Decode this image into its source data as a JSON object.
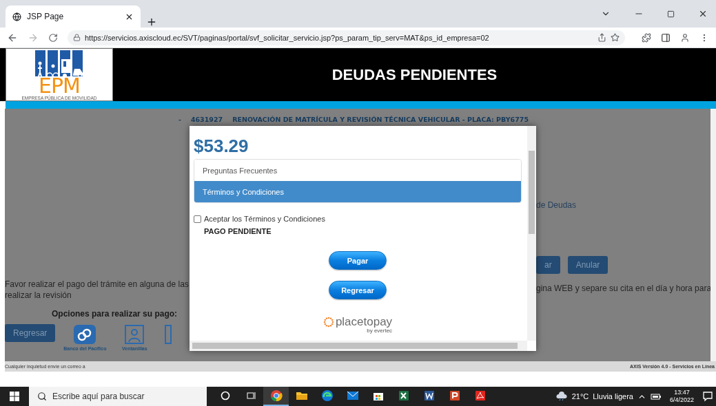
{
  "browser": {
    "tab_title": "JSP Page",
    "url": "https://servicios.axiscloud.ec/SVT/paginas/portal/svf_solicitar_servicio.jsp?ps_param_tip_serv=MAT&ps_id_empresa=02"
  },
  "header": {
    "logo_text": "EPM",
    "logo_subtitle": "EMPRESA PÚBLICA DE MOVILIDAD",
    "title": "DEUDAS PENDIENTES"
  },
  "service_line": {
    "dash": "-",
    "number": "4631927",
    "description": "RENOVACIÓN DE MATRÍCULA Y REVISIÓN TÉCNICA VEHICULAR - PLACA: PBY6775"
  },
  "background": {
    "right_link": "de Deudas",
    "right_buttons": [
      "ar",
      "Anular"
    ],
    "notice_left": "Favor realizar el pago del trámite en alguna de las",
    "notice_right": "gina WEB y separe su cita en el día y hora para",
    "notice_continued": "realizar la revisión",
    "payment_options_title": "Opciones para realizar su pago:",
    "back_button": "Regresar",
    "payment_options": [
      {
        "kind": "bank",
        "label": "Banco del Pacífico"
      },
      {
        "kind": "counter",
        "label": "Ventanillas"
      },
      {
        "kind": "partial"
      }
    ]
  },
  "modal": {
    "amount": "$53.29",
    "menu": [
      {
        "label": "Preguntas Frecuentes",
        "selected": false
      },
      {
        "label": "Términos y Condiciones",
        "selected": true
      }
    ],
    "accept_checkbox": {
      "label": "Aceptar los Términos y Condiciones",
      "checked": false
    },
    "status": "PAGO PENDIENTE",
    "buttons": [
      "Pagar",
      "Regresar"
    ],
    "brand": {
      "name": "placetopay",
      "byline": "by evertec"
    }
  },
  "footer": {
    "left": "Cualquier inquietud envíe un correo a",
    "right": "AXIS Versión 4.0 - Servicios en Línea"
  },
  "taskbar": {
    "search_placeholder": "Escribe aquí para buscar",
    "apps": [
      {
        "kind": "cortana",
        "selected": false
      },
      {
        "kind": "taskview",
        "selected": false
      },
      {
        "kind": "chrome",
        "selected": true
      },
      {
        "kind": "folder",
        "selected": false
      },
      {
        "kind": "edge",
        "selected": false
      },
      {
        "kind": "mail",
        "selected": false
      },
      {
        "kind": "store",
        "selected": false
      },
      {
        "kind": "excel",
        "selected": false
      },
      {
        "kind": "word",
        "selected": false
      },
      {
        "kind": "powerpoint",
        "selected": false
      },
      {
        "kind": "pdf",
        "selected": false
      }
    ],
    "temperature": "21°C",
    "weather": "Lluvia ligera",
    "time": "13:47",
    "date": "6/4/2022"
  }
}
